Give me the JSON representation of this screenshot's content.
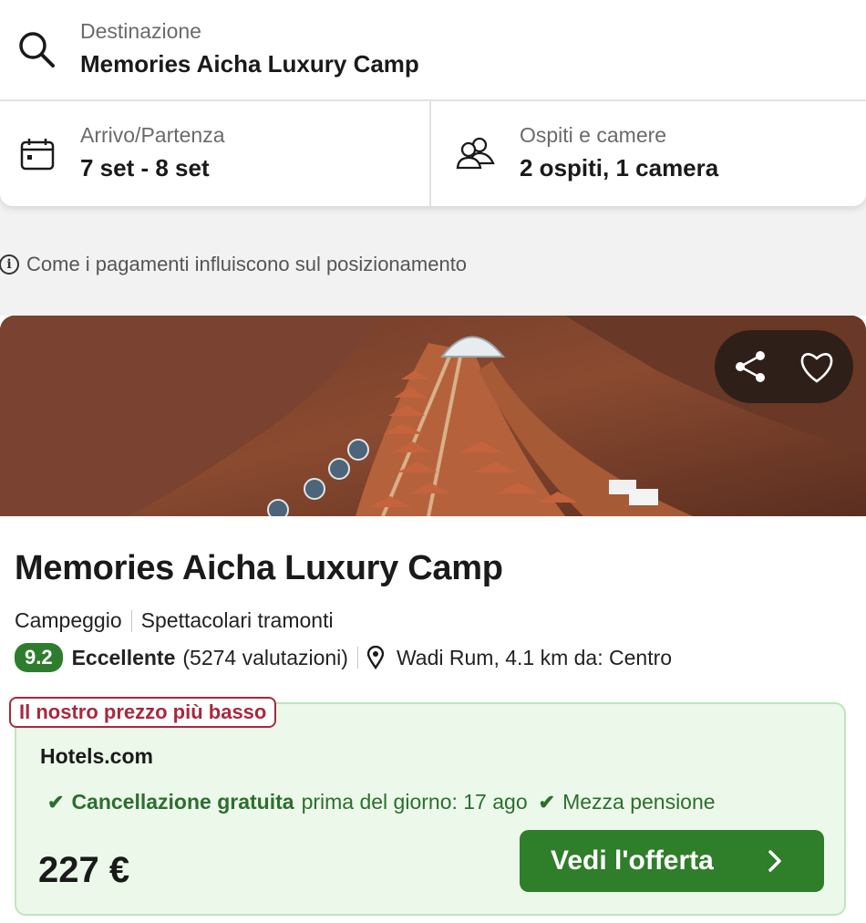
{
  "search": {
    "destination_label": "Destinazione",
    "destination_value": "Memories Aicha Luxury Camp",
    "dates_label": "Arrivo/Partenza",
    "dates_value": "7 set - 8 set",
    "guests_label": "Ospiti e camere",
    "guests_value": "2 ospiti, 1 camera"
  },
  "info_note": "Come i pagamenti influiscono sul posizionamento",
  "listing": {
    "name": "Memories Aicha Luxury Camp",
    "type": "Campeggio",
    "highlight": "Spettacolari tramonti",
    "score": "9.2",
    "rating_word": "Eccellente",
    "review_count": "(5274 valutazioni)",
    "location": "Wadi Rum, 4.1 km da: Centro",
    "photo_icons": [
      "share-icon",
      "heart-icon"
    ]
  },
  "offer": {
    "tag": "Il nostro prezzo più basso",
    "provider": "Hotels.com",
    "cancellation_bold": "Cancellazione gratuita",
    "cancellation_rest": "prima del giorno: 17 ago",
    "meal_plan": "Mezza pensione",
    "price": "227 €",
    "cta_label": "Vedi l'offerta"
  },
  "colors": {
    "accent_green": "#2f7e2a",
    "score_green": "#2e7d2e",
    "offer_bg": "#ebf8ea",
    "tag_red": "#a8283f"
  }
}
